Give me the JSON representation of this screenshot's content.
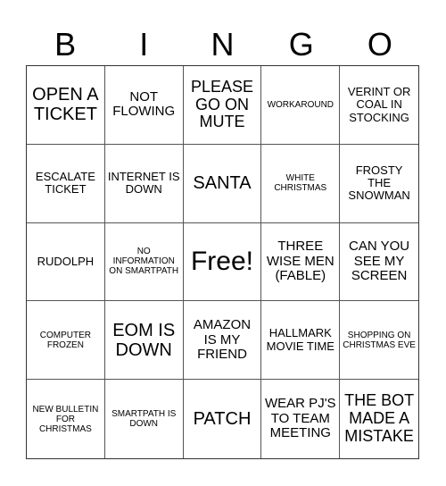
{
  "header": {
    "letters": [
      "B",
      "I",
      "N",
      "G",
      "O"
    ]
  },
  "card": {
    "rows": [
      [
        {
          "text": "OPEN A TICKET",
          "size": "s-xl"
        },
        {
          "text": "NOT FLOWING",
          "size": "s-m"
        },
        {
          "text": "PLEASE GO ON MUTE",
          "size": "s-l"
        },
        {
          "text": "WORKAROUND",
          "size": "s-xs"
        },
        {
          "text": "VERINT OR COAL IN STOCKING",
          "size": "s-s"
        }
      ],
      [
        {
          "text": "ESCALATE TICKET",
          "size": "s-s"
        },
        {
          "text": "INTERNET IS DOWN",
          "size": "s-s"
        },
        {
          "text": "SANTA",
          "size": "s-xl"
        },
        {
          "text": "WHITE CHRISTMAS",
          "size": "s-xs"
        },
        {
          "text": "FROSTY THE SNOWMAN",
          "size": "s-s"
        }
      ],
      [
        {
          "text": "RUDOLPH",
          "size": "s-s"
        },
        {
          "text": "NO INFORMATION ON SMARTPATH",
          "size": "s-xs"
        },
        {
          "text": "Free!",
          "size": "s-free"
        },
        {
          "text": "THREE WISE MEN (FABLE)",
          "size": "s-m"
        },
        {
          "text": "CAN YOU SEE MY SCREEN",
          "size": "s-m"
        }
      ],
      [
        {
          "text": "COMPUTER FROZEN",
          "size": "s-xs"
        },
        {
          "text": "EOM IS DOWN",
          "size": "s-xl"
        },
        {
          "text": "AMAZON IS MY FRIEND",
          "size": "s-m"
        },
        {
          "text": "HALLMARK MOVIE TIME",
          "size": "s-s"
        },
        {
          "text": "SHOPPING ON CHRISTMAS EVE",
          "size": "s-xs"
        }
      ],
      [
        {
          "text": "NEW BULLETIN FOR CHRISTMAS",
          "size": "s-xs"
        },
        {
          "text": "SMARTPATH IS DOWN",
          "size": "s-xs"
        },
        {
          "text": "PATCH",
          "size": "s-xl"
        },
        {
          "text": "WEAR PJ'S TO TEAM MEETING",
          "size": "s-m"
        },
        {
          "text": "THE BOT MADE A MISTAKE",
          "size": "s-l"
        }
      ]
    ]
  }
}
